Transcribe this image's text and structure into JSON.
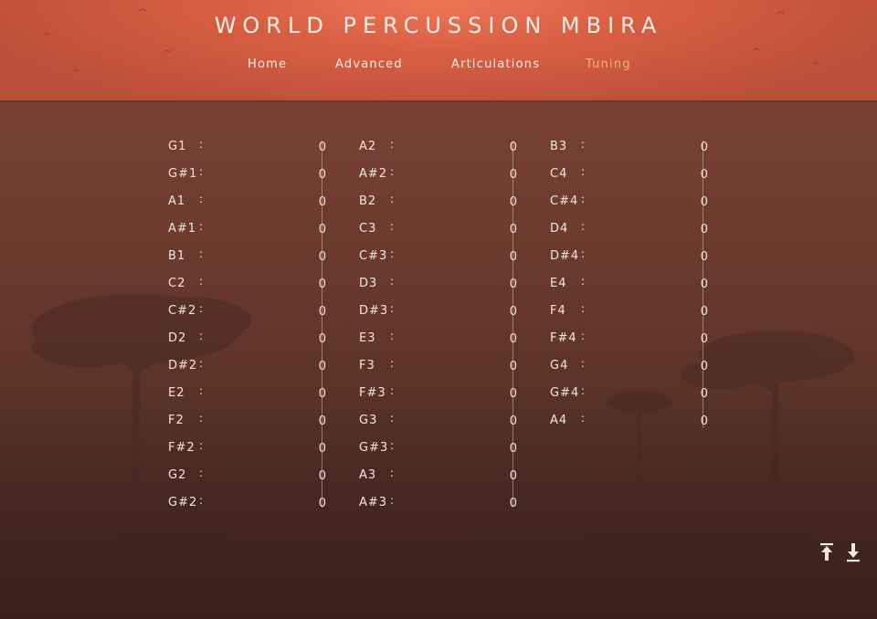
{
  "header": {
    "title": "WORLD PERCUSSION MBIRA",
    "nav": [
      {
        "label": "Home",
        "active": false
      },
      {
        "label": "Advanced",
        "active": false
      },
      {
        "label": "Articulations",
        "active": false
      },
      {
        "label": "Tuning",
        "active": true
      }
    ]
  },
  "tuning": {
    "columns": [
      [
        {
          "note": "G1",
          "value": "0"
        },
        {
          "note": "G#1",
          "value": "0"
        },
        {
          "note": "A1",
          "value": "0"
        },
        {
          "note": "A#1",
          "value": "0"
        },
        {
          "note": "B1",
          "value": "0"
        },
        {
          "note": "C2",
          "value": "0"
        },
        {
          "note": "C#2",
          "value": "0"
        },
        {
          "note": "D2",
          "value": "0"
        },
        {
          "note": "D#2",
          "value": "0"
        },
        {
          "note": "E2",
          "value": "0"
        },
        {
          "note": "F2",
          "value": "0"
        },
        {
          "note": "F#2",
          "value": "0"
        },
        {
          "note": "G2",
          "value": "0"
        },
        {
          "note": "G#2",
          "value": "0"
        }
      ],
      [
        {
          "note": "A2",
          "value": "0"
        },
        {
          "note": "A#2",
          "value": "0"
        },
        {
          "note": "B2",
          "value": "0"
        },
        {
          "note": "C3",
          "value": "0"
        },
        {
          "note": "C#3",
          "value": "0"
        },
        {
          "note": "D3",
          "value": "0"
        },
        {
          "note": "D#3",
          "value": "0"
        },
        {
          "note": "E3",
          "value": "0"
        },
        {
          "note": "F3",
          "value": "0"
        },
        {
          "note": "F#3",
          "value": "0"
        },
        {
          "note": "G3",
          "value": "0"
        },
        {
          "note": "G#3",
          "value": "0"
        },
        {
          "note": "A3",
          "value": "0"
        },
        {
          "note": "A#3",
          "value": "0"
        }
      ],
      [
        {
          "note": "B3",
          "value": "0"
        },
        {
          "note": "C4",
          "value": "0"
        },
        {
          "note": "C#4",
          "value": "0"
        },
        {
          "note": "D4",
          "value": "0"
        },
        {
          "note": "D#4",
          "value": "0"
        },
        {
          "note": "E4",
          "value": "0"
        },
        {
          "note": "F4",
          "value": "0"
        },
        {
          "note": "F#4",
          "value": "0"
        },
        {
          "note": "G4",
          "value": "0"
        },
        {
          "note": "G#4",
          "value": "0"
        },
        {
          "note": "A4",
          "value": "0"
        }
      ]
    ],
    "separator": ":"
  },
  "footer": {
    "icons": [
      "upload-icon",
      "download-icon"
    ]
  },
  "colors": {
    "header_accent": "#d85e42",
    "active_nav": "#f6b07a",
    "text": "#f2e6e0"
  }
}
